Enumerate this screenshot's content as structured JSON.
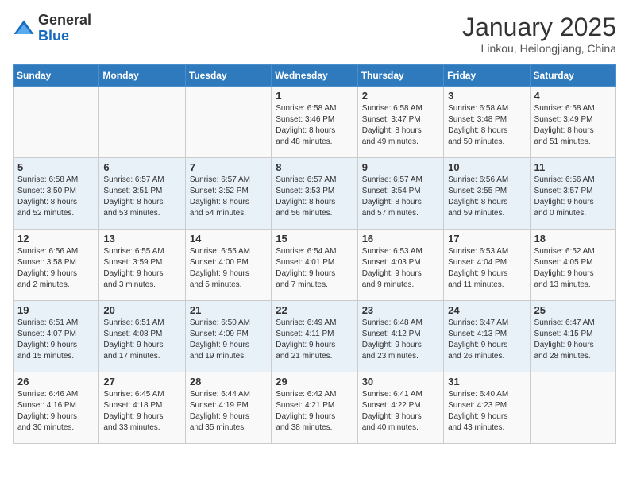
{
  "logo": {
    "general": "General",
    "blue": "Blue"
  },
  "header": {
    "month": "January 2025",
    "location": "Linkou, Heilongjiang, China"
  },
  "weekdays": [
    "Sunday",
    "Monday",
    "Tuesday",
    "Wednesday",
    "Thursday",
    "Friday",
    "Saturday"
  ],
  "weeks": [
    [
      {
        "day": "",
        "info": ""
      },
      {
        "day": "",
        "info": ""
      },
      {
        "day": "",
        "info": ""
      },
      {
        "day": "1",
        "info": "Sunrise: 6:58 AM\nSunset: 3:46 PM\nDaylight: 8 hours\nand 48 minutes."
      },
      {
        "day": "2",
        "info": "Sunrise: 6:58 AM\nSunset: 3:47 PM\nDaylight: 8 hours\nand 49 minutes."
      },
      {
        "day": "3",
        "info": "Sunrise: 6:58 AM\nSunset: 3:48 PM\nDaylight: 8 hours\nand 50 minutes."
      },
      {
        "day": "4",
        "info": "Sunrise: 6:58 AM\nSunset: 3:49 PM\nDaylight: 8 hours\nand 51 minutes."
      }
    ],
    [
      {
        "day": "5",
        "info": "Sunrise: 6:58 AM\nSunset: 3:50 PM\nDaylight: 8 hours\nand 52 minutes."
      },
      {
        "day": "6",
        "info": "Sunrise: 6:57 AM\nSunset: 3:51 PM\nDaylight: 8 hours\nand 53 minutes."
      },
      {
        "day": "7",
        "info": "Sunrise: 6:57 AM\nSunset: 3:52 PM\nDaylight: 8 hours\nand 54 minutes."
      },
      {
        "day": "8",
        "info": "Sunrise: 6:57 AM\nSunset: 3:53 PM\nDaylight: 8 hours\nand 56 minutes."
      },
      {
        "day": "9",
        "info": "Sunrise: 6:57 AM\nSunset: 3:54 PM\nDaylight: 8 hours\nand 57 minutes."
      },
      {
        "day": "10",
        "info": "Sunrise: 6:56 AM\nSunset: 3:55 PM\nDaylight: 8 hours\nand 59 minutes."
      },
      {
        "day": "11",
        "info": "Sunrise: 6:56 AM\nSunset: 3:57 PM\nDaylight: 9 hours\nand 0 minutes."
      }
    ],
    [
      {
        "day": "12",
        "info": "Sunrise: 6:56 AM\nSunset: 3:58 PM\nDaylight: 9 hours\nand 2 minutes."
      },
      {
        "day": "13",
        "info": "Sunrise: 6:55 AM\nSunset: 3:59 PM\nDaylight: 9 hours\nand 3 minutes."
      },
      {
        "day": "14",
        "info": "Sunrise: 6:55 AM\nSunset: 4:00 PM\nDaylight: 9 hours\nand 5 minutes."
      },
      {
        "day": "15",
        "info": "Sunrise: 6:54 AM\nSunset: 4:01 PM\nDaylight: 9 hours\nand 7 minutes."
      },
      {
        "day": "16",
        "info": "Sunrise: 6:53 AM\nSunset: 4:03 PM\nDaylight: 9 hours\nand 9 minutes."
      },
      {
        "day": "17",
        "info": "Sunrise: 6:53 AM\nSunset: 4:04 PM\nDaylight: 9 hours\nand 11 minutes."
      },
      {
        "day": "18",
        "info": "Sunrise: 6:52 AM\nSunset: 4:05 PM\nDaylight: 9 hours\nand 13 minutes."
      }
    ],
    [
      {
        "day": "19",
        "info": "Sunrise: 6:51 AM\nSunset: 4:07 PM\nDaylight: 9 hours\nand 15 minutes."
      },
      {
        "day": "20",
        "info": "Sunrise: 6:51 AM\nSunset: 4:08 PM\nDaylight: 9 hours\nand 17 minutes."
      },
      {
        "day": "21",
        "info": "Sunrise: 6:50 AM\nSunset: 4:09 PM\nDaylight: 9 hours\nand 19 minutes."
      },
      {
        "day": "22",
        "info": "Sunrise: 6:49 AM\nSunset: 4:11 PM\nDaylight: 9 hours\nand 21 minutes."
      },
      {
        "day": "23",
        "info": "Sunrise: 6:48 AM\nSunset: 4:12 PM\nDaylight: 9 hours\nand 23 minutes."
      },
      {
        "day": "24",
        "info": "Sunrise: 6:47 AM\nSunset: 4:13 PM\nDaylight: 9 hours\nand 26 minutes."
      },
      {
        "day": "25",
        "info": "Sunrise: 6:47 AM\nSunset: 4:15 PM\nDaylight: 9 hours\nand 28 minutes."
      }
    ],
    [
      {
        "day": "26",
        "info": "Sunrise: 6:46 AM\nSunset: 4:16 PM\nDaylight: 9 hours\nand 30 minutes."
      },
      {
        "day": "27",
        "info": "Sunrise: 6:45 AM\nSunset: 4:18 PM\nDaylight: 9 hours\nand 33 minutes."
      },
      {
        "day": "28",
        "info": "Sunrise: 6:44 AM\nSunset: 4:19 PM\nDaylight: 9 hours\nand 35 minutes."
      },
      {
        "day": "29",
        "info": "Sunrise: 6:42 AM\nSunset: 4:21 PM\nDaylight: 9 hours\nand 38 minutes."
      },
      {
        "day": "30",
        "info": "Sunrise: 6:41 AM\nSunset: 4:22 PM\nDaylight: 9 hours\nand 40 minutes."
      },
      {
        "day": "31",
        "info": "Sunrise: 6:40 AM\nSunset: 4:23 PM\nDaylight: 9 hours\nand 43 minutes."
      },
      {
        "day": "",
        "info": ""
      }
    ]
  ]
}
